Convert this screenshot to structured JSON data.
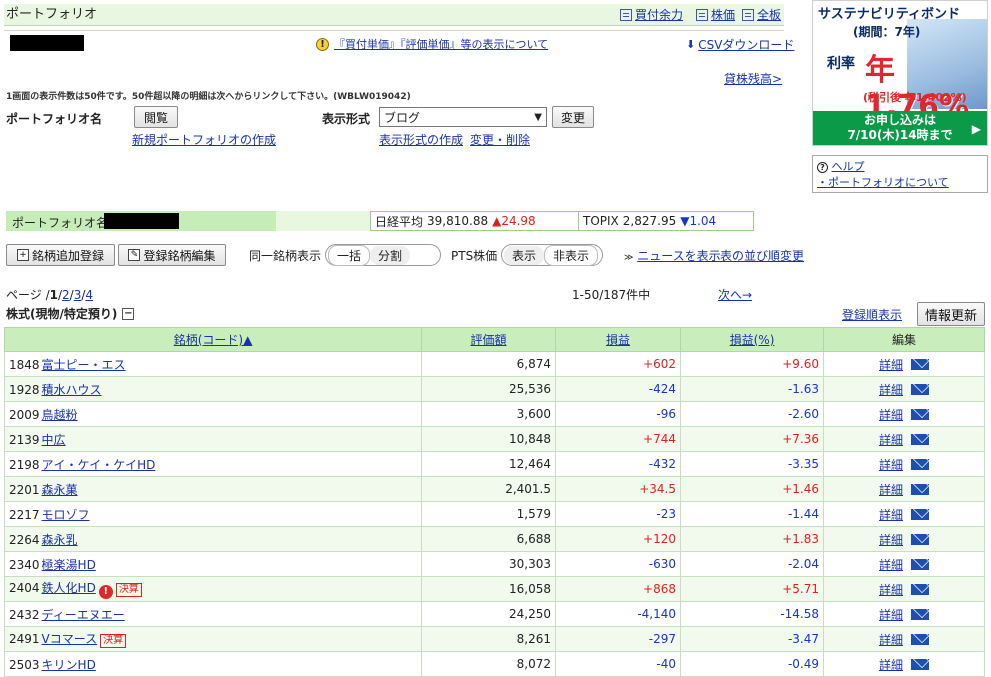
{
  "header": {
    "title": "ポートフォリオ",
    "links": [
      "買付余力",
      "株価",
      "全板"
    ],
    "notice": "『買付単価』『評価単価』等の表示について",
    "csv": "CSVダウンロード",
    "lending": "貸株残高>",
    "display_count": "1画面の表示件数は50件です。50件超以降の明細は次へからリンクして下さい。(WBLW019042)"
  },
  "controls": {
    "portfolio_label": "ポートフォリオ名",
    "browse_button": "閲覧",
    "new_portfolio_link": "新規ポートフォリオの作成",
    "format_label": "表示形式",
    "format_selected": "ブログ",
    "change_button": "変更",
    "format_create_link": "表示形式の作成",
    "format_edit_link": "変更・削除"
  },
  "banner": {
    "title": "サステナビリティボンド",
    "period": "(期間：7年)",
    "rate_label": "利率",
    "rate": "年1.76%",
    "after_tax": "(税引後 年1.402%)",
    "apply_line1": "お申し込みは",
    "apply_line2": "7/10(木)14時まで",
    "arrow": "▶"
  },
  "help": {
    "help_link": "ヘルプ",
    "about_link": "・ポートフォリオについて"
  },
  "portfolio_bar": {
    "name_label": "ポートフォリオ名 /",
    "nikkei_label": "日経平均",
    "nikkei_value": "39,810.88",
    "nikkei_change": "▲24.98",
    "topix_label": "TOPIX",
    "topix_value": "2,827.95",
    "topix_change": "▼1.04"
  },
  "actions": {
    "add_button": "銘柄追加登録",
    "edit_button": "登録銘柄編集",
    "same_label": "同一銘柄表示",
    "same_on": "一括",
    "same_off": "分割",
    "pts_label": "PTS株価",
    "pts_on": "表示",
    "pts_off": "非表示",
    "news_link": "ニュースを表示",
    "order_link": "表の並び順変更"
  },
  "paging": {
    "prefix": "ページ /",
    "current": "1",
    "pages": [
      "2",
      "3",
      "4"
    ],
    "count": "1-50/187件中",
    "next": "次へ→"
  },
  "section": {
    "title": "株式(現物/特定預り)",
    "toggle": "−",
    "reg_order_link": "登録順表示",
    "refresh_button": "情報更新"
  },
  "table": {
    "headers": [
      "銘柄(コード)▲",
      "評価額",
      "損益",
      "損益(%)",
      "編集"
    ],
    "detail_label": "詳細",
    "rows": [
      {
        "code": "1848",
        "name": "富士ピー・エス",
        "value": "6,874",
        "pl": "+602",
        "pct": "+9.60",
        "sign": "pos"
      },
      {
        "code": "1928",
        "name": "積水ハウス",
        "value": "25,536",
        "pl": "-424",
        "pct": "-1.63",
        "sign": "neg"
      },
      {
        "code": "2009",
        "name": "鳥越粉",
        "value": "3,600",
        "pl": "-96",
        "pct": "-2.60",
        "sign": "neg"
      },
      {
        "code": "2139",
        "name": "中広",
        "value": "10,848",
        "pl": "+744",
        "pct": "+7.36",
        "sign": "pos"
      },
      {
        "code": "2198",
        "name": "アイ・ケイ・ケイHD",
        "value": "12,464",
        "pl": "-432",
        "pct": "-3.35",
        "sign": "neg"
      },
      {
        "code": "2201",
        "name": "森永菓",
        "value": "2,401.5",
        "pl": "+34.5",
        "pct": "+1.46",
        "sign": "pos"
      },
      {
        "code": "2217",
        "name": "モロゾフ",
        "value": "1,579",
        "pl": "-23",
        "pct": "-1.44",
        "sign": "neg"
      },
      {
        "code": "2264",
        "name": "森永乳",
        "value": "6,688",
        "pl": "+120",
        "pct": "+1.83",
        "sign": "pos"
      },
      {
        "code": "2340",
        "name": "極楽湯HD",
        "value": "30,303",
        "pl": "-630",
        "pct": "-2.04",
        "sign": "neg"
      },
      {
        "code": "2404",
        "name": "鉄人化HD",
        "value": "16,058",
        "pl": "+868",
        "pct": "+5.71",
        "sign": "pos",
        "alert": "!",
        "badge": "決算"
      },
      {
        "code": "2432",
        "name": "ディーエヌエー",
        "value": "24,250",
        "pl": "-4,140",
        "pct": "-14.58",
        "sign": "neg"
      },
      {
        "code": "2491",
        "name": "Vコマース",
        "value": "8,261",
        "pl": "-297",
        "pct": "-3.47",
        "sign": "neg",
        "badge": "決算"
      },
      {
        "code": "2503",
        "name": "キリンHD",
        "value": "8,072",
        "pl": "-40",
        "pct": "-0.49",
        "sign": "neg"
      }
    ]
  }
}
